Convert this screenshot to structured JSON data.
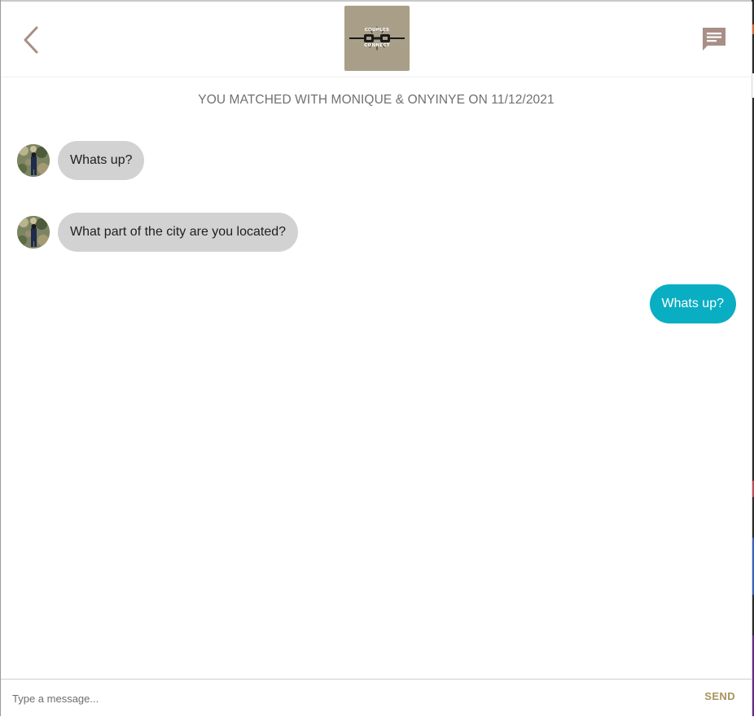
{
  "header": {
    "back_icon": "chevron-left-icon",
    "logo": {
      "line1": "COUPLES",
      "line2": "CONNECT",
      "background": "#a99e88"
    },
    "chat_icon": "message-icon"
  },
  "match_banner": "YOU MATCHED WITH MONIQUE & ONYINYE ON 11/12/2021",
  "messages": [
    {
      "direction": "incoming",
      "text": "Whats up?"
    },
    {
      "direction": "incoming",
      "text": "What part of the city are you located?"
    },
    {
      "direction": "outgoing",
      "text": "Whats up?"
    }
  ],
  "composer": {
    "placeholder": "Type a message...",
    "send_label": "SEND"
  },
  "colors": {
    "incoming_bubble": "#d2d2d2",
    "outgoing_bubble": "#0aaec3",
    "accent": "#a8935c",
    "icon": "#a88f86"
  }
}
